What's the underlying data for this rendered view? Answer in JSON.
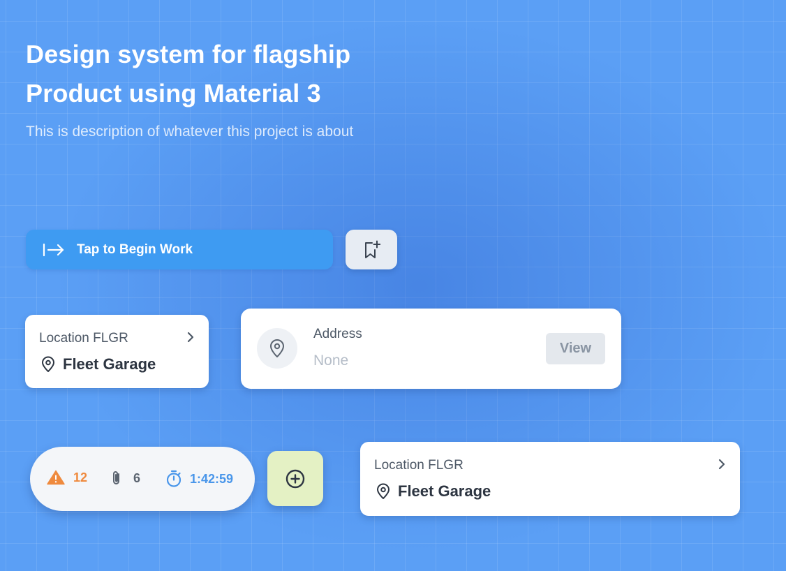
{
  "hero": {
    "title_line1": "Design system for flagship",
    "title_line2": "Product using Material 3",
    "description": "This is description of whatever this project is about"
  },
  "begin_work": {
    "label": "Tap to Begin Work",
    "icon": "arrow-to-right-icon"
  },
  "bookmark": {
    "icon": "bookmark-add-icon"
  },
  "location_card_1": {
    "label": "Location FLGR",
    "name": "Fleet Garage",
    "icon": "location-pin-icon"
  },
  "address_card": {
    "label": "Address",
    "value": "None",
    "action_label": "View",
    "icon": "location-pin-icon"
  },
  "status": {
    "warnings": "12",
    "attachments": "6",
    "timer": "1:42:59",
    "colors": {
      "warning": "#ef8a3e",
      "timer": "#4996ea",
      "attachment": "#5b6470"
    }
  },
  "add_button": {
    "icon": "plus-circle-icon",
    "color": "#e4f1c4"
  },
  "location_card_2": {
    "label": "Location FLGR",
    "name": "Fleet Garage",
    "icon": "location-pin-icon"
  },
  "colors": {
    "background": "#5b9ff5",
    "primary_button": "#3e9bf2",
    "card": "#ffffff",
    "text_dark": "#2d3541"
  }
}
